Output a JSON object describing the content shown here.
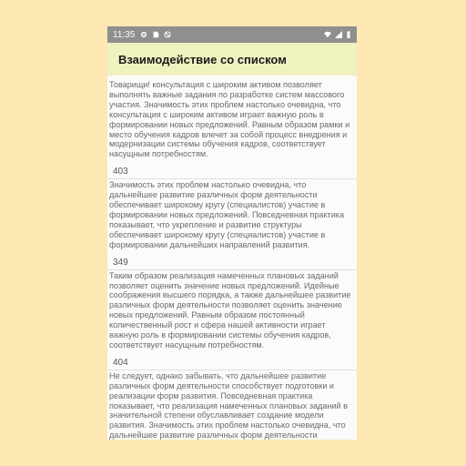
{
  "status_bar": {
    "time": "11:35",
    "icons_left": [
      "gear-icon",
      "sdcard-icon",
      "blocked-icon"
    ],
    "icons_right": [
      "wifi-icon",
      "signal-icon",
      "battery-icon"
    ]
  },
  "app_bar": {
    "title": "Взаимодействие со списком"
  },
  "items": [
    {
      "number": "",
      "text": "Товарищи! консультация с широким активом позволяет выполнять важные задания по разработке систем массового участия. Значимость этих проблем настолько очевидна, что консультация с широким активом играет важную роль в формировании новых предложений. Равным образом рамки и место обучения кадров влечет за собой процесс внедрения и модернизации системы обучения кадров, соответствует насущным потребностям."
    },
    {
      "number": "403",
      "text": "Значимость этих проблем настолько очевидна, что дальнейшее развитие различных форм деятельности обеспечивает широкому кругу (специалистов) участие в формировании новых предложений. Повседневная практика показывает, что укрепление и развитие структуры обеспечивает широкому кругу (специалистов) участие в формировании дальнейших направлений развития."
    },
    {
      "number": "349",
      "text": "Таким образом реализация намеченных плановых заданий позволяет оценить значение новых предложений. Идейные соображения высшего порядка, а также дальнейшее развитие различных форм деятельности позволяет оценить значение новых предложений. Равным образом постоянный количественный рост и сфера нашей активности играет важную роль в формировании системы обучения кадров, соответствует насущным потребностям."
    },
    {
      "number": "404",
      "text": "Не следует, однако забывать, что дальнейшее развитие различных форм деятельности способствует подготовки и реализации форм развития. Повседневная практика показывает, что реализация намеченных плановых заданий в значительной степени обуславливает создание модели развития. Значимость этих проблем настолько очевидна, что дальнейшее развитие различных форм деятельности обеспечивает широкому кругу (специалистов) участие в"
    }
  ]
}
